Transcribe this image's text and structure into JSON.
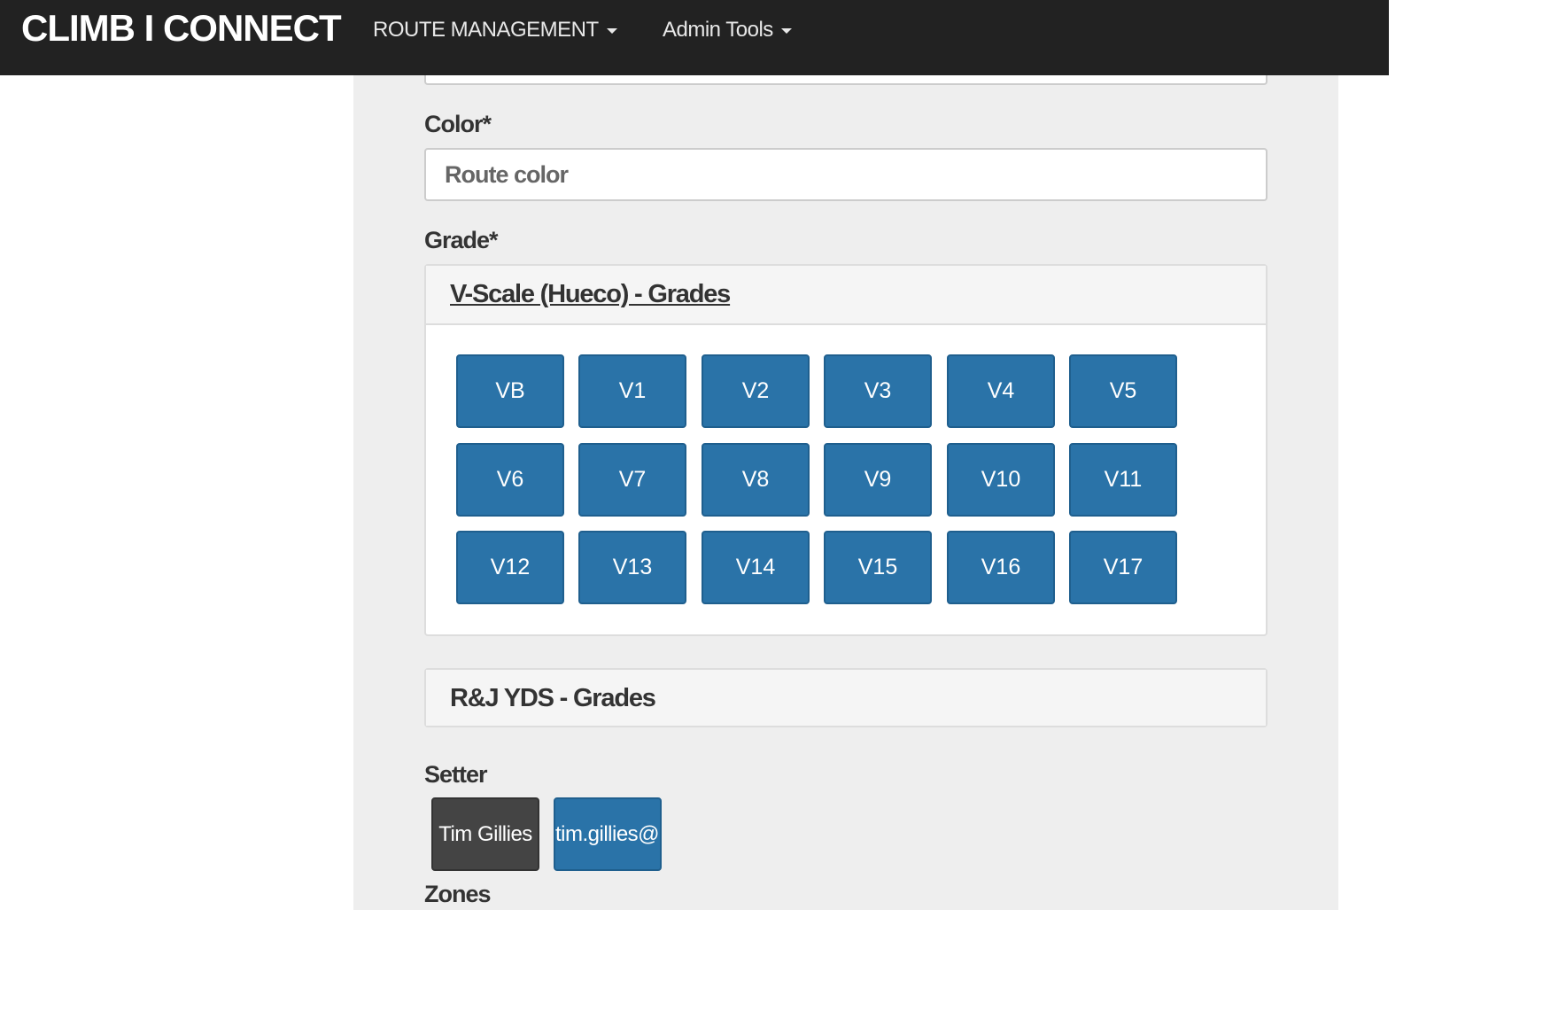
{
  "navbar": {
    "brand": "CLIMB I CONNECT",
    "route_management": "ROUTE MANAGEMENT",
    "admin_tools": "Admin Tools"
  },
  "form": {
    "color": {
      "label": "Color*",
      "placeholder": "Route color",
      "value": ""
    },
    "grade": {
      "label": "Grade*",
      "vscale_title": "V-Scale (Hueco) - Grades",
      "vscale_grades": [
        "VB",
        "V1",
        "V2",
        "V3",
        "V4",
        "V5",
        "V6",
        "V7",
        "V8",
        "V9",
        "V10",
        "V11",
        "V12",
        "V13",
        "V14",
        "V15",
        "V16",
        "V17"
      ],
      "yds_title": "R&J YDS - Grades"
    },
    "setter": {
      "label": "Setter",
      "name": "Tim Gillies",
      "email": "tim.gillies@"
    },
    "zones": {
      "label": "Zones"
    }
  },
  "colors": {
    "navbar_bg": "#222222",
    "grade_button": "#2a73a8",
    "setter_name_button": "#444444",
    "panel_bg": "#eeeeee"
  }
}
